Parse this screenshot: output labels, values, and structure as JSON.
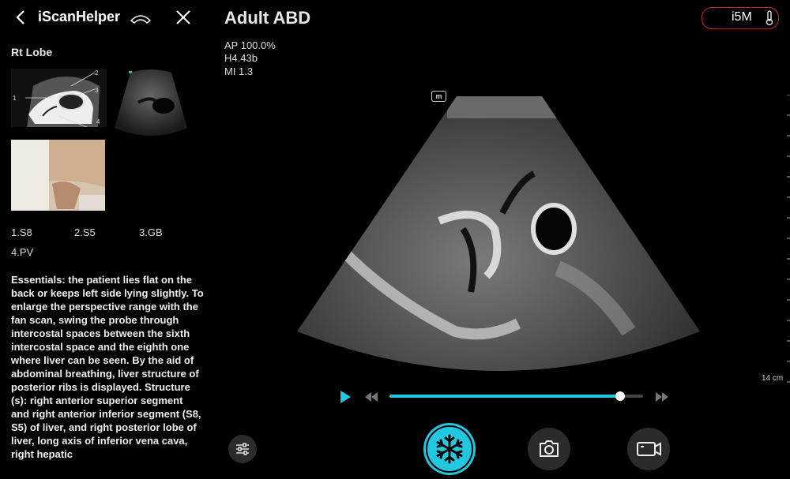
{
  "helper": {
    "title": "iScanHelper",
    "section": "Rt Lobe",
    "diagram_labels": [
      "1",
      "2",
      "3",
      "4"
    ],
    "legend": [
      "1.S8",
      "2.S5",
      "3.GB",
      "4.PV"
    ],
    "description": "Essentials: the patient lies flat on the back or keeps left side lying slightly. To enlarge the perspective range with the fan scan, swing the probe through intercostal spaces between the sixth intercostal space and the eighth one where liver can be seen. By the aid of abdominal breathing, liver structure of posterior ribs is displayed. Structure (s): right anterior superior segment and right anterior inferior segment (S8, S5) of liver, and right posterior lobe of liver, long axis of inferior vena cava, right hepatic"
  },
  "exam": {
    "title": "Adult ABD",
    "params": [
      "AP 100.0%",
      "H4.43b",
      "MI 1.3"
    ],
    "probe": "i5M",
    "marker": "m",
    "depth": "14 cm"
  },
  "playback": {
    "progress": 0.91
  },
  "colors": {
    "accent": "#22c8e0",
    "probe_border": "#c62828",
    "button_bg": "#2b2b2b"
  },
  "icons": {
    "back": "chevron-left-icon",
    "probe": "probe-icon",
    "close": "close-icon",
    "thermometer": "thermometer-icon",
    "play": "play-icon",
    "rewind": "rewind-icon",
    "fast_forward": "fast-forward-icon",
    "settings": "sliders-icon",
    "freeze": "snowflake-icon",
    "camera": "camera-icon",
    "video": "video-icon"
  }
}
